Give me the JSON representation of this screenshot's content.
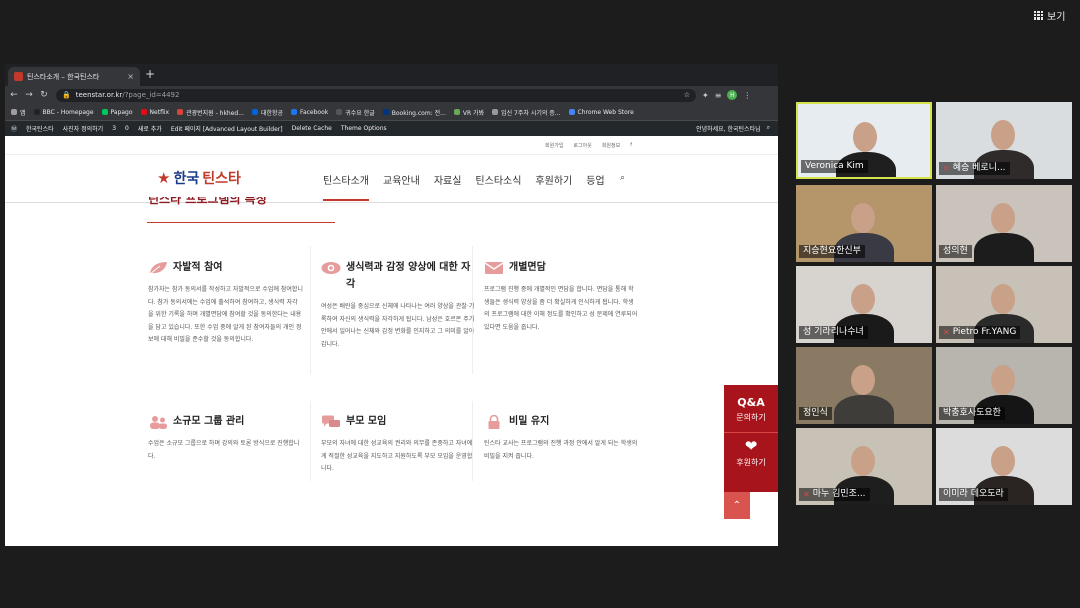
{
  "zoom": {
    "view_label": "보기"
  },
  "browser": {
    "tab_title": "틴스타소개 – 한국틴스타",
    "tab_close": "×",
    "new_tab": "+",
    "url_host": "teenstar.or.kr",
    "url_path": "/?page_id=4492",
    "profile_initial": "H",
    "bookmarks": [
      {
        "label": "앱",
        "color": "#9e9e9e"
      },
      {
        "label": "BBC - Homepage",
        "color": "#222"
      },
      {
        "label": "Papago",
        "color": "#03c75a"
      },
      {
        "label": "Netflix",
        "color": "#e50914"
      },
      {
        "label": "관광번지원 - hkhed...",
        "color": "#d44638"
      },
      {
        "label": "대한항공",
        "color": "#0064de"
      },
      {
        "label": "Facebook",
        "color": "#1877f2"
      },
      {
        "label": "귀수요 한글",
        "color": "#555"
      },
      {
        "label": "Booking.com: 전...",
        "color": "#003580"
      },
      {
        "label": "VR 가봐",
        "color": "#6a5"
      },
      {
        "label": "임신 7주차 시기의 증...",
        "color": "#999"
      },
      {
        "label": "Chrome Web Store",
        "color": "#4285f4"
      }
    ],
    "wp_items": [
      "한국틴스타",
      "사진자 정의하기",
      "3",
      "0",
      "새로 추가",
      "Edit 페이지 [Advanced Layout Builder]",
      "Delete Cache",
      "Theme Options"
    ],
    "wp_greeting": "안녕하세요, 한국틴스타님"
  },
  "site": {
    "util_links": [
      "회원가입",
      "로그아웃",
      "회원정보",
      "f"
    ],
    "logo_main": "한국",
    "logo_accent": "틴스타",
    "nav": [
      "틴스타소개",
      "교육안내",
      "자료실",
      "틴스타소식",
      "후원하기",
      "등업"
    ],
    "section_title": "틴스타 프로그램의 특징",
    "features": [
      {
        "title": "자발적 참여",
        "icon": "leaf-icon",
        "body": "참가자는 참가 동의서를 작성하고 자발적으로 수업에 참여합니다. 참가 동의서에는 수업에 출석하여 참여하고, 생식력 자각을 위한 기록을 하며 개별면담에 참여할 것을 동의한다는 내용을 담고 있습니다. 또한 수업 중에 알게 된 참여자들의 개인 정보에 대해 비밀을 준수할 것을 동의합니다."
      },
      {
        "title": "생식력과 감정 양상에 대한 자각",
        "icon": "eye-icon",
        "body": "여성은 배란을 중심으로 신체에 나타나는 여러 양상을 관찰·기록하여 자신의 생식력을 자각하게 됩니다. 남성은 호르몬 주기 안에서 일어나는 신체와 감정 변화를 인지하고 그 의미를 알아갑니다."
      },
      {
        "title": "개별면담",
        "icon": "envelope-icon",
        "body": "프로그램 진행 중에 개별적인 면담을 합니다. 면담을 통해 학생들은 생식력 양상을 좀 더 확실하게 인식하게 됩니다. 학생의 프로그램에 대한 이해 정도를 확인하고 성 문제에 연루되어 있다면 도움을 줍니다."
      },
      {
        "title": "소규모 그룹 관리",
        "icon": "group-icon",
        "body": "수업은 소규모 그룹으로 하며 강의와 토론 방식으로 진행합니다."
      },
      {
        "title": "부모 모임",
        "icon": "chat-icon",
        "body": "부모의 자녀에 대한 성교육의 권리와 의무를 존중하고 자녀에게 적절한 성교육을 지도하고 지원하도록 부모 모임을 운영합니다."
      },
      {
        "title": "비밀 유지",
        "icon": "lock-icon",
        "body": "틴스타 교사는 프로그램의 진행 과정 안에서 알게 되는 학생의 비밀을 지켜 줍니다."
      }
    ],
    "qa": {
      "title": "Q&A",
      "subtitle": "문의하기",
      "donate": "후원하기",
      "top": "⌃"
    }
  },
  "participants": [
    {
      "name": "Veronica Kim",
      "muted": false,
      "active": true
    },
    {
      "name": "혜승 베로니...",
      "muted": true,
      "active": false
    },
    {
      "name": "지승현요한신부",
      "muted": false,
      "active": false
    },
    {
      "name": "성의현",
      "muted": false,
      "active": false
    },
    {
      "name": "성 기라리나수녀",
      "muted": false,
      "active": false
    },
    {
      "name": "Pietro Fr.YANG",
      "muted": true,
      "active": false
    },
    {
      "name": "정인식",
      "muted": false,
      "active": false
    },
    {
      "name": "박충호사도요한",
      "muted": false,
      "active": false
    },
    {
      "name": "마누 김민조...",
      "muted": true,
      "active": false
    },
    {
      "name": "이미라 데오도라",
      "muted": false,
      "active": false
    }
  ]
}
